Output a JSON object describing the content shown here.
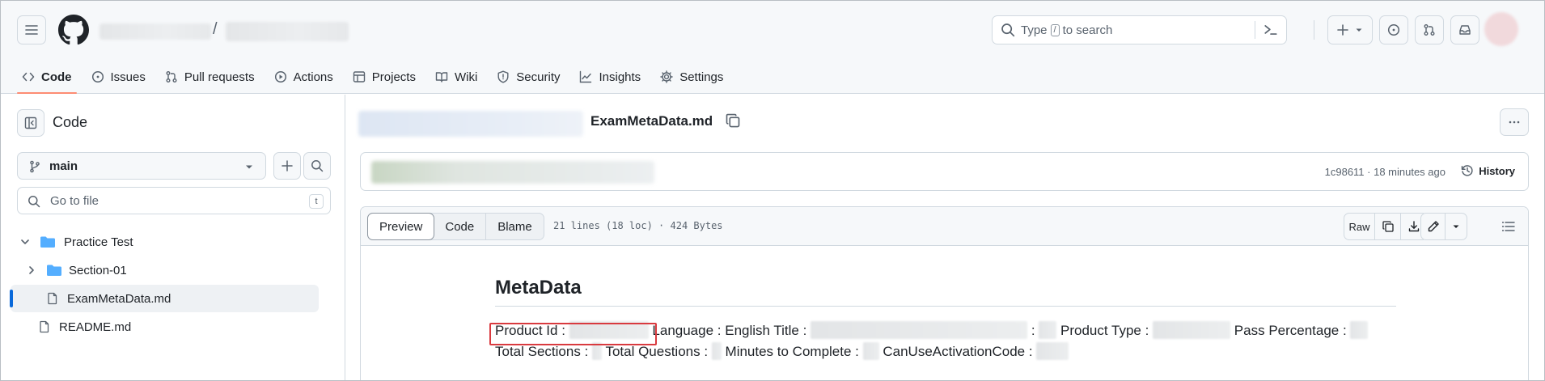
{
  "header": {
    "path_separator": "/",
    "search": {
      "prefix": "Type",
      "key": "/",
      "suffix": "to search"
    },
    "tabs": [
      {
        "label": "Code",
        "icon": "code-icon",
        "active": true
      },
      {
        "label": "Issues",
        "icon": "issue-icon"
      },
      {
        "label": "Pull requests",
        "icon": "pull-request-icon"
      },
      {
        "label": "Actions",
        "icon": "play-icon"
      },
      {
        "label": "Projects",
        "icon": "table-icon"
      },
      {
        "label": "Wiki",
        "icon": "book-icon"
      },
      {
        "label": "Security",
        "icon": "shield-icon"
      },
      {
        "label": "Insights",
        "icon": "graph-icon"
      },
      {
        "label": "Settings",
        "icon": "gear-icon"
      }
    ]
  },
  "sidebar": {
    "title": "Code",
    "branch": "main",
    "go_to_file": {
      "placeholder": "Go to file",
      "shortcut": "t"
    },
    "tree": [
      {
        "label": "Practice Test",
        "type": "folder-open",
        "level": 0
      },
      {
        "label": "Section-01",
        "type": "folder",
        "level": 1
      },
      {
        "label": "ExamMetaData.md",
        "type": "file",
        "level": 1,
        "selected": true
      },
      {
        "label": "README.md",
        "type": "file",
        "level": 0
      }
    ]
  },
  "main": {
    "filename": "ExamMetaData.md",
    "commit_meta": "1c98611 · 18 minutes ago",
    "history_label": "History",
    "view_modes": [
      "Preview",
      "Code",
      "Blame"
    ],
    "file_info": "21 lines (18 loc) · 424 Bytes",
    "raw_label": "Raw",
    "markdown": {
      "heading": "MetaData",
      "fields": {
        "product_id": "Product Id :",
        "language": "Language :",
        "english_title": "English Title :",
        "colon": ":",
        "product_type": "Product Type :",
        "pass_percentage": "Pass Percentage :",
        "total_sections": "Total Sections :",
        "total_questions": "Total Questions :",
        "minutes": "Minutes to Complete :",
        "can_use": "CanUseActivationCode :"
      }
    }
  },
  "colors": {
    "accent_underline": "#fd8c73",
    "selection_bar": "#0969da",
    "highlight_box": "#d93a3f",
    "folder": "#54aeff"
  }
}
